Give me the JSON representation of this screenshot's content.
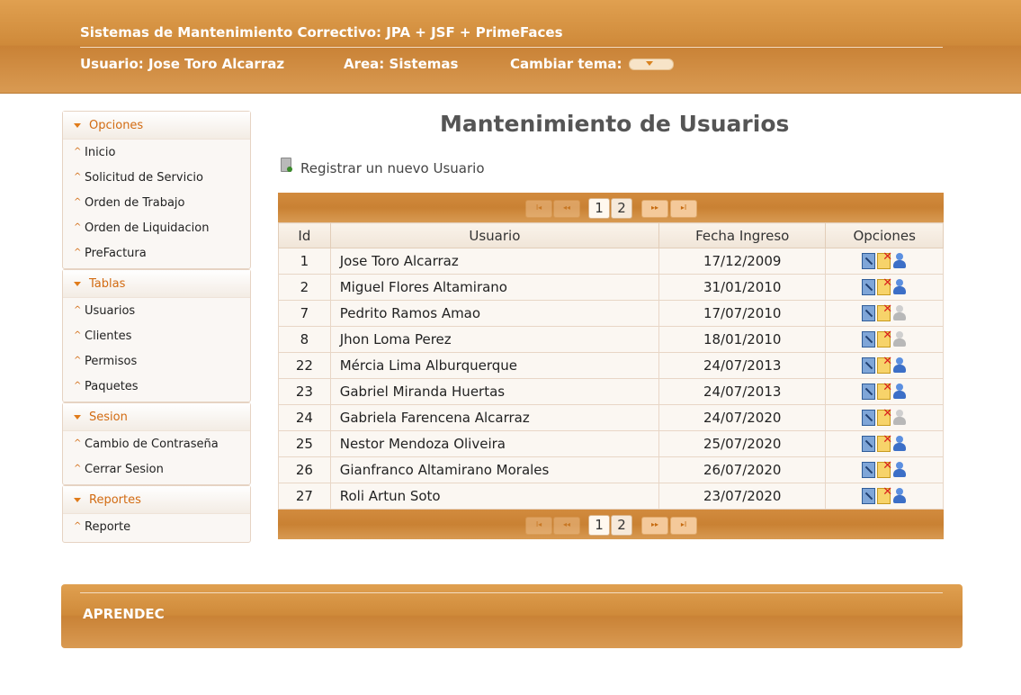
{
  "header": {
    "title": "Sistemas de Mantenimiento Correctivo: JPA + JSF + PrimeFaces",
    "user": "Usuario: Jose Toro Alcarraz",
    "area": "Area: Sistemas",
    "theme_label": "Cambiar tema:"
  },
  "sidebar": {
    "panels": [
      {
        "title": "Opciones",
        "items": [
          "Inicio",
          "Solicitud de Servicio",
          "Orden de Trabajo",
          "Orden de Liquidacion",
          "PreFactura"
        ]
      },
      {
        "title": "Tablas",
        "items": [
          "Usuarios",
          "Clientes",
          "Permisos",
          "Paquetes"
        ]
      },
      {
        "title": "Sesion",
        "items": [
          "Cambio de Contraseña",
          "Cerrar Sesion"
        ]
      },
      {
        "title": "Reportes",
        "items": [
          "Reporte"
        ]
      }
    ]
  },
  "main": {
    "title": "Mantenimiento de Usuarios",
    "register_link": "Registrar un nuevo Usuario",
    "pages": [
      "1",
      "2"
    ],
    "columns": [
      "Id",
      "Usuario",
      "Fecha Ingreso",
      "Opciones"
    ],
    "rows": [
      {
        "id": "1",
        "user": "Jose Toro Alcarraz",
        "date": "17/12/2009",
        "active": true
      },
      {
        "id": "2",
        "user": "Miguel Flores Altamirano",
        "date": "31/01/2010",
        "active": true
      },
      {
        "id": "7",
        "user": "Pedrito Ramos Amao",
        "date": "17/07/2010",
        "active": false
      },
      {
        "id": "8",
        "user": "Jhon Loma Perez",
        "date": "18/01/2010",
        "active": false
      },
      {
        "id": "22",
        "user": "Mércia Lima Alburquerque",
        "date": "24/07/2013",
        "active": true
      },
      {
        "id": "23",
        "user": "Gabriel Miranda Huertas",
        "date": "24/07/2013",
        "active": true
      },
      {
        "id": "24",
        "user": "Gabriela Farencena Alcarraz",
        "date": "24/07/2020",
        "active": false
      },
      {
        "id": "25",
        "user": "Nestor Mendoza Oliveira",
        "date": "25/07/2020",
        "active": true
      },
      {
        "id": "26",
        "user": "Gianfranco Altamirano Morales",
        "date": "26/07/2020",
        "active": true
      },
      {
        "id": "27",
        "user": "Roli Artun Soto",
        "date": "23/07/2020",
        "active": true
      }
    ]
  },
  "footer": {
    "text": "APRENDEC"
  },
  "colors": {
    "accent": "#cf8a3a",
    "link": "#d26b12"
  }
}
